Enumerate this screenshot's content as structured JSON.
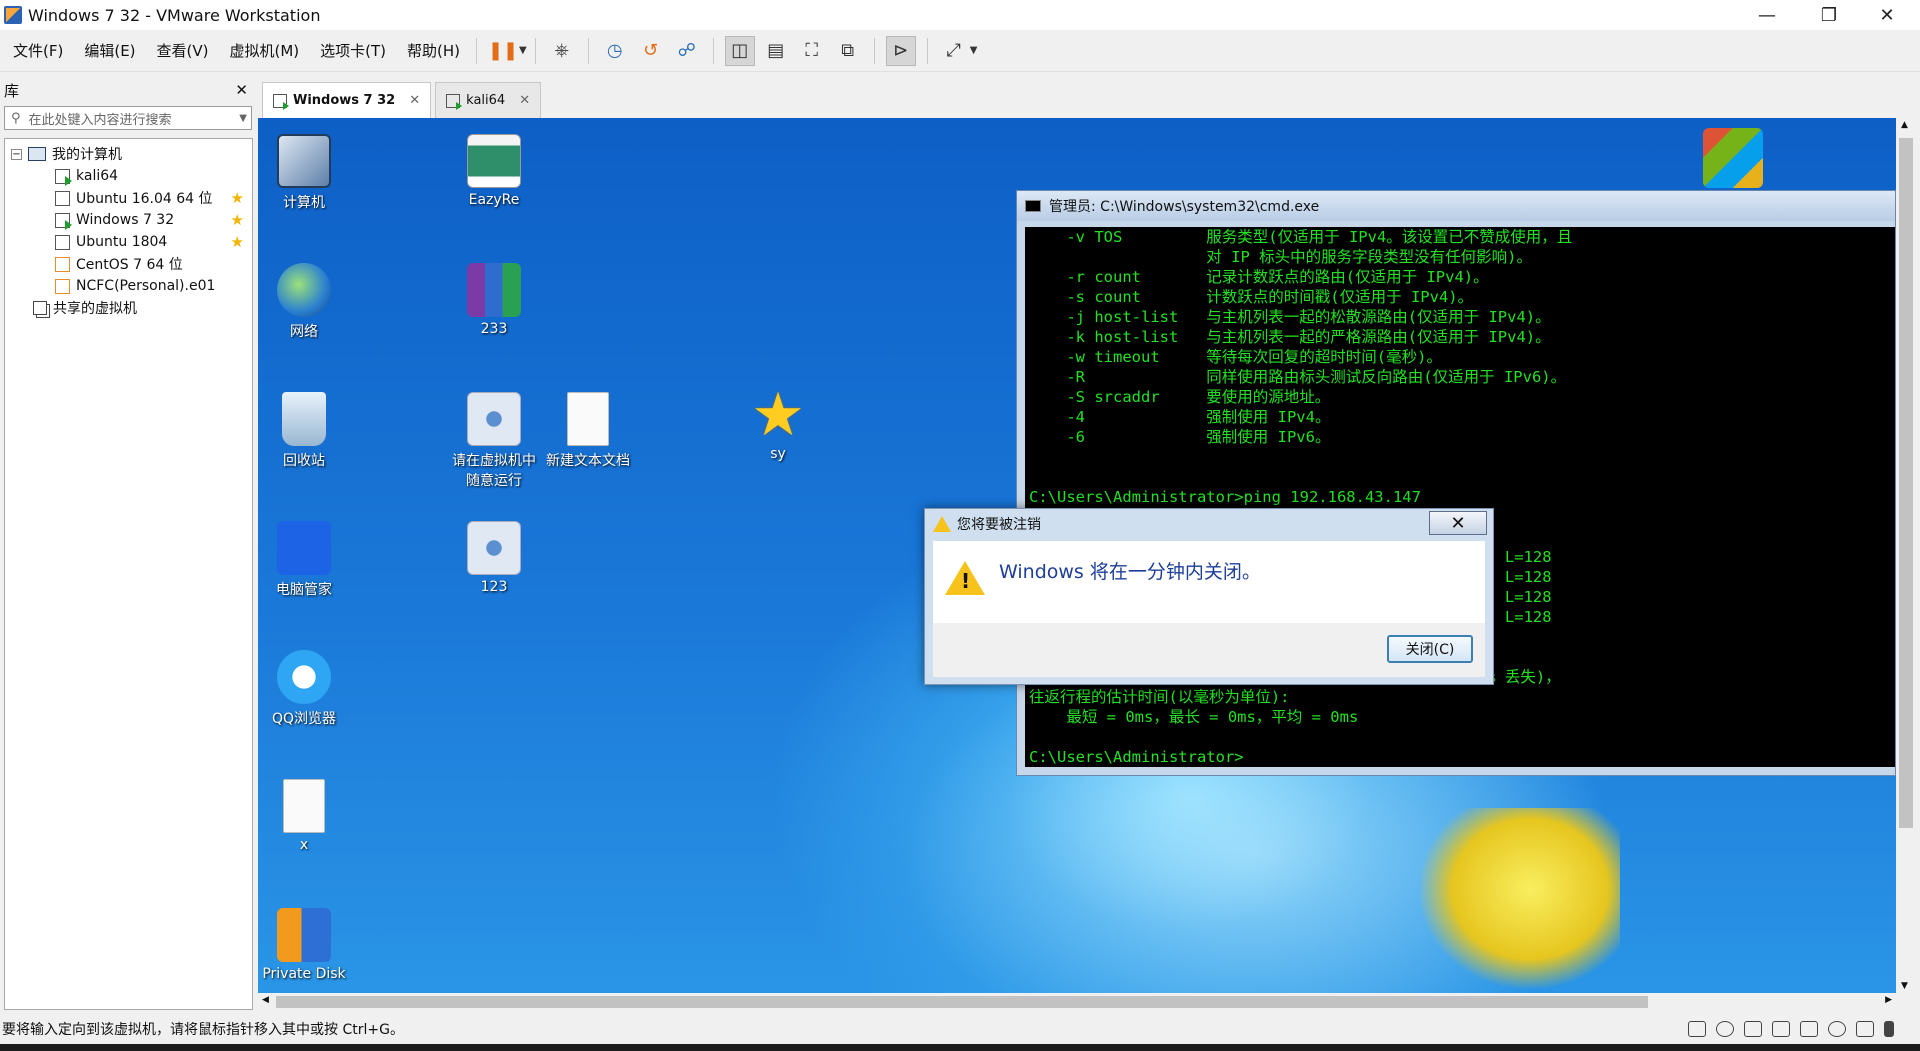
{
  "window": {
    "title": "Windows 7 32 - VMware Workstation"
  },
  "menu": [
    "文件(F)",
    "编辑(E)",
    "查看(V)",
    "虚拟机(M)",
    "选项卡(T)",
    "帮助(H)"
  ],
  "library": {
    "title": "库",
    "search_placeholder": "在此处键入内容进行搜索",
    "root": "我的计算机",
    "vms": [
      {
        "name": "kali64",
        "starred": false
      },
      {
        "name": "Ubuntu 16.04 64 位",
        "starred": true
      },
      {
        "name": "Windows 7 32",
        "starred": true
      },
      {
        "name": "Ubuntu 1804",
        "starred": true
      },
      {
        "name": "CentOS 7 64 位",
        "starred": false
      },
      {
        "name": "NCFC(Personal).e01",
        "starred": false
      }
    ],
    "shared": "共享的虚拟机"
  },
  "tabs": [
    {
      "label": "Windows 7 32"
    },
    {
      "label": "kali64"
    }
  ],
  "desktop": {
    "icons": [
      {
        "label": "计算机",
        "icon": "computer-icon"
      },
      {
        "label": "网络",
        "icon": "network-icon"
      },
      {
        "label": "回收站",
        "icon": "recycle-bin-icon"
      },
      {
        "label": "电脑管家",
        "icon": "shield-icon"
      },
      {
        "label": "QQ浏览器",
        "icon": "browser-icon"
      },
      {
        "label": "x",
        "icon": "document-icon"
      },
      {
        "label": "Private Disk",
        "icon": "private-disk-icon"
      },
      {
        "label": "EazyRe",
        "icon": "app-icon"
      },
      {
        "label": "233",
        "icon": "archive-icon"
      },
      {
        "label": "请在虚拟机中随意运行",
        "icon": "gear-doc-icon"
      },
      {
        "label": "新建文本文档",
        "icon": "document-icon"
      },
      {
        "label": "sy",
        "icon": "star-icon"
      },
      {
        "label": "123",
        "icon": "gear-doc-icon"
      }
    ]
  },
  "cmd": {
    "title": "管理员: C:\\Windows\\system32\\cmd.exe",
    "lines": [
      "    -v TOS         服务类型(仅适用于 IPv4。该设置已不赞成使用，且",
      "                   对 IP 标头中的服务字段类型没有任何影响)。",
      "    -r count       记录计数跃点的路由(仅适用于 IPv4)。",
      "    -s count       计数跃点的时间戳(仅适用于 IPv4)。",
      "    -j host-list   与主机列表一起的松散源路由(仅适用于 IPv4)。",
      "    -k host-list   与主机列表一起的严格源路由(仅适用于 IPv4)。",
      "    -w timeout     等待每次回复的超时时间(毫秒)。",
      "    -R             同样使用路由标头测试反向路由(仅适用于 IPv6)。",
      "    -S srcaddr     要使用的源地址。",
      "    -4             强制使用 IPv4。",
      "    -6             强制使用 IPv6。",
      "",
      "",
      "C:\\Users\\Administrator>ping 192.168.43.147",
      "",
      "",
      "                                                   L=128",
      "                                                   L=128",
      "                                                   L=128",
      "                                                   L=128",
      "",
      "",
      "                                                 % 丢失)，",
      "往返行程的估计时间(以毫秒为单位):",
      "    最短 = 0ms，最长 = 0ms，平均 = 0ms",
      "",
      "C:\\Users\\Administrator>"
    ]
  },
  "dialog": {
    "title": "您将要被注销",
    "message": "Windows 将在一分钟内关闭。",
    "close_button": "关闭(C)"
  },
  "status": {
    "text": "要将输入定向到该虚拟机，请将鼠标指针移入其中或按 Ctrl+G。"
  }
}
